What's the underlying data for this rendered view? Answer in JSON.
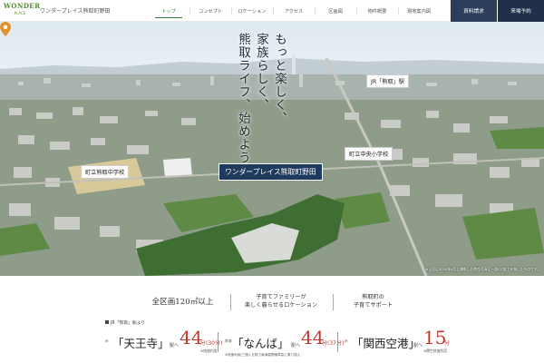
{
  "header": {
    "logo_text": "WONDER",
    "logo_sub": "PLACE",
    "site_name": "ワンダープレイス熊取町野田",
    "nav": [
      "トップ",
      "コンセプト",
      "ロケーション",
      "アクセス",
      "区画図",
      "物件概要",
      "現地案内図"
    ],
    "active_nav": "トップ",
    "doc_request": "資料請求",
    "visit_reserve": "来場予約"
  },
  "hero": {
    "catch_lines": [
      "もっと楽しく、",
      "家族らしく、",
      "熊取ライフ、始めよう。"
    ],
    "catch_col1": "もっと楽しく、",
    "catch_col2": "家族らしく、",
    "catch_col3": "熊取ライフ、始めよう。",
    "label_station": "JR「熊取」駅",
    "label_elementary": "町立中央小学校",
    "label_junior": "町立熊取中学校",
    "label_site": "ワンダープレイス熊取町野田",
    "disclaimer": "※上記は2020年6月に撮影した航空写真に一部CG加工を施したものです。"
  },
  "features": {
    "f1": "全区画120㎡以上",
    "f2_line1": "子育てファミリーが",
    "f2_line2": "楽しく暮らせるロケーション",
    "f3_line1": "熊取町の",
    "f3_line2": "子育てサポート"
  },
  "access": {
    "heading": "JR「熊取」駅より",
    "items": [
      {
        "prefix": "JR",
        "station": "「天王寺」",
        "to": "駅へ",
        "minutes": "44",
        "unit": "分(30分)",
        "note": "※快速利用"
      },
      {
        "prefix": "南海",
        "station": "「なんば」",
        "to": "駅へ",
        "minutes": "44",
        "unit": "分(37分)",
        "note": "※快速利用/三国ヶ丘駅で南海高野線準急に乗り換え"
      },
      {
        "prefix": "JR",
        "station": "「関西空港」",
        "to": "駅へ",
        "minutes": "15",
        "unit": "分",
        "note": "※関空快速利用"
      }
    ]
  },
  "colors": {
    "accent_green": "#2f7f3a",
    "navy": "#2c3e5a",
    "dark_navy": "#20304a",
    "red": "#c23a2e"
  }
}
